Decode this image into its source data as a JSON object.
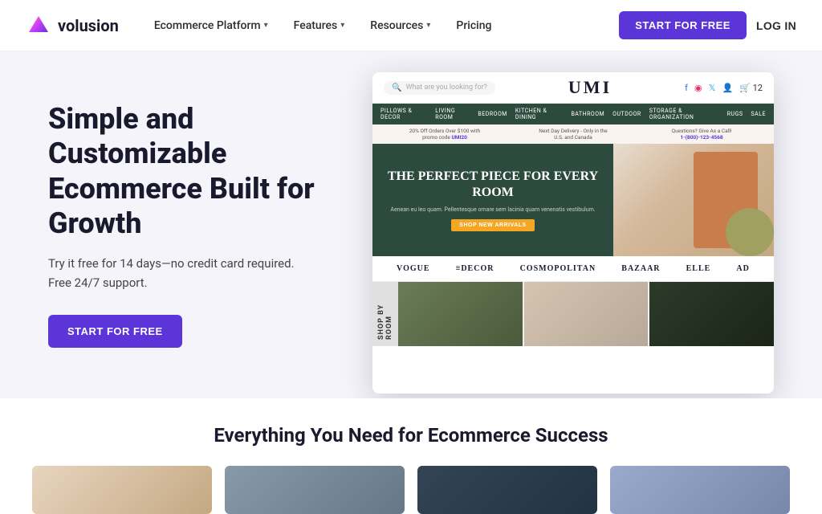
{
  "nav": {
    "logo_text": "volusion",
    "links": [
      {
        "label": "Ecommerce Platform",
        "has_dropdown": true
      },
      {
        "label": "Features",
        "has_dropdown": true
      },
      {
        "label": "Resources",
        "has_dropdown": true
      }
    ],
    "pricing_label": "Pricing",
    "start_free_label": "START FOR FREE",
    "login_label": "LOG IN"
  },
  "hero": {
    "title": "Simple and Customizable Ecommerce Built for Growth",
    "subtitle_line1": "Try it free for 14 days—no credit card required.",
    "subtitle_line2": "Free 24/7 support.",
    "cta_label": "START FOR FREE"
  },
  "store_preview": {
    "search_placeholder": "What are you looking for?",
    "brand_name": "UMI",
    "nav_items": [
      "PILLOWS & DECOR",
      "LIVING ROOM",
      "BEDROOM",
      "KITCHEN & DINING",
      "BATHROOM",
      "OUTDOOR",
      "STORAGE & ORGANIZATION",
      "RUGS",
      "SALE"
    ],
    "banner_items": [
      "20% Off Orders Over $100 with promo code UMI20",
      "Next Day Delivery - Only in the U.S. and Canada",
      "Questions? Give As a Call! 1-(800)-123-4568"
    ],
    "hero_title": "THE PERFECT PIECE FOR EVERY ROOM",
    "hero_sub": "Aenean eu leo quam. Pellentesque ornare sem lacinia quam venenatis vestibulum.",
    "hero_btn": "SHOP NEW ARRIVALS",
    "logos": [
      "VOGUE",
      "≡DECOR",
      "COSMOPOLITAN",
      "BAZAAR",
      "ELLE",
      "AD"
    ],
    "shop_by_room": "SHOP BY ROOM"
  },
  "bottom": {
    "title": "Everything You Need for Ecommerce Success"
  }
}
